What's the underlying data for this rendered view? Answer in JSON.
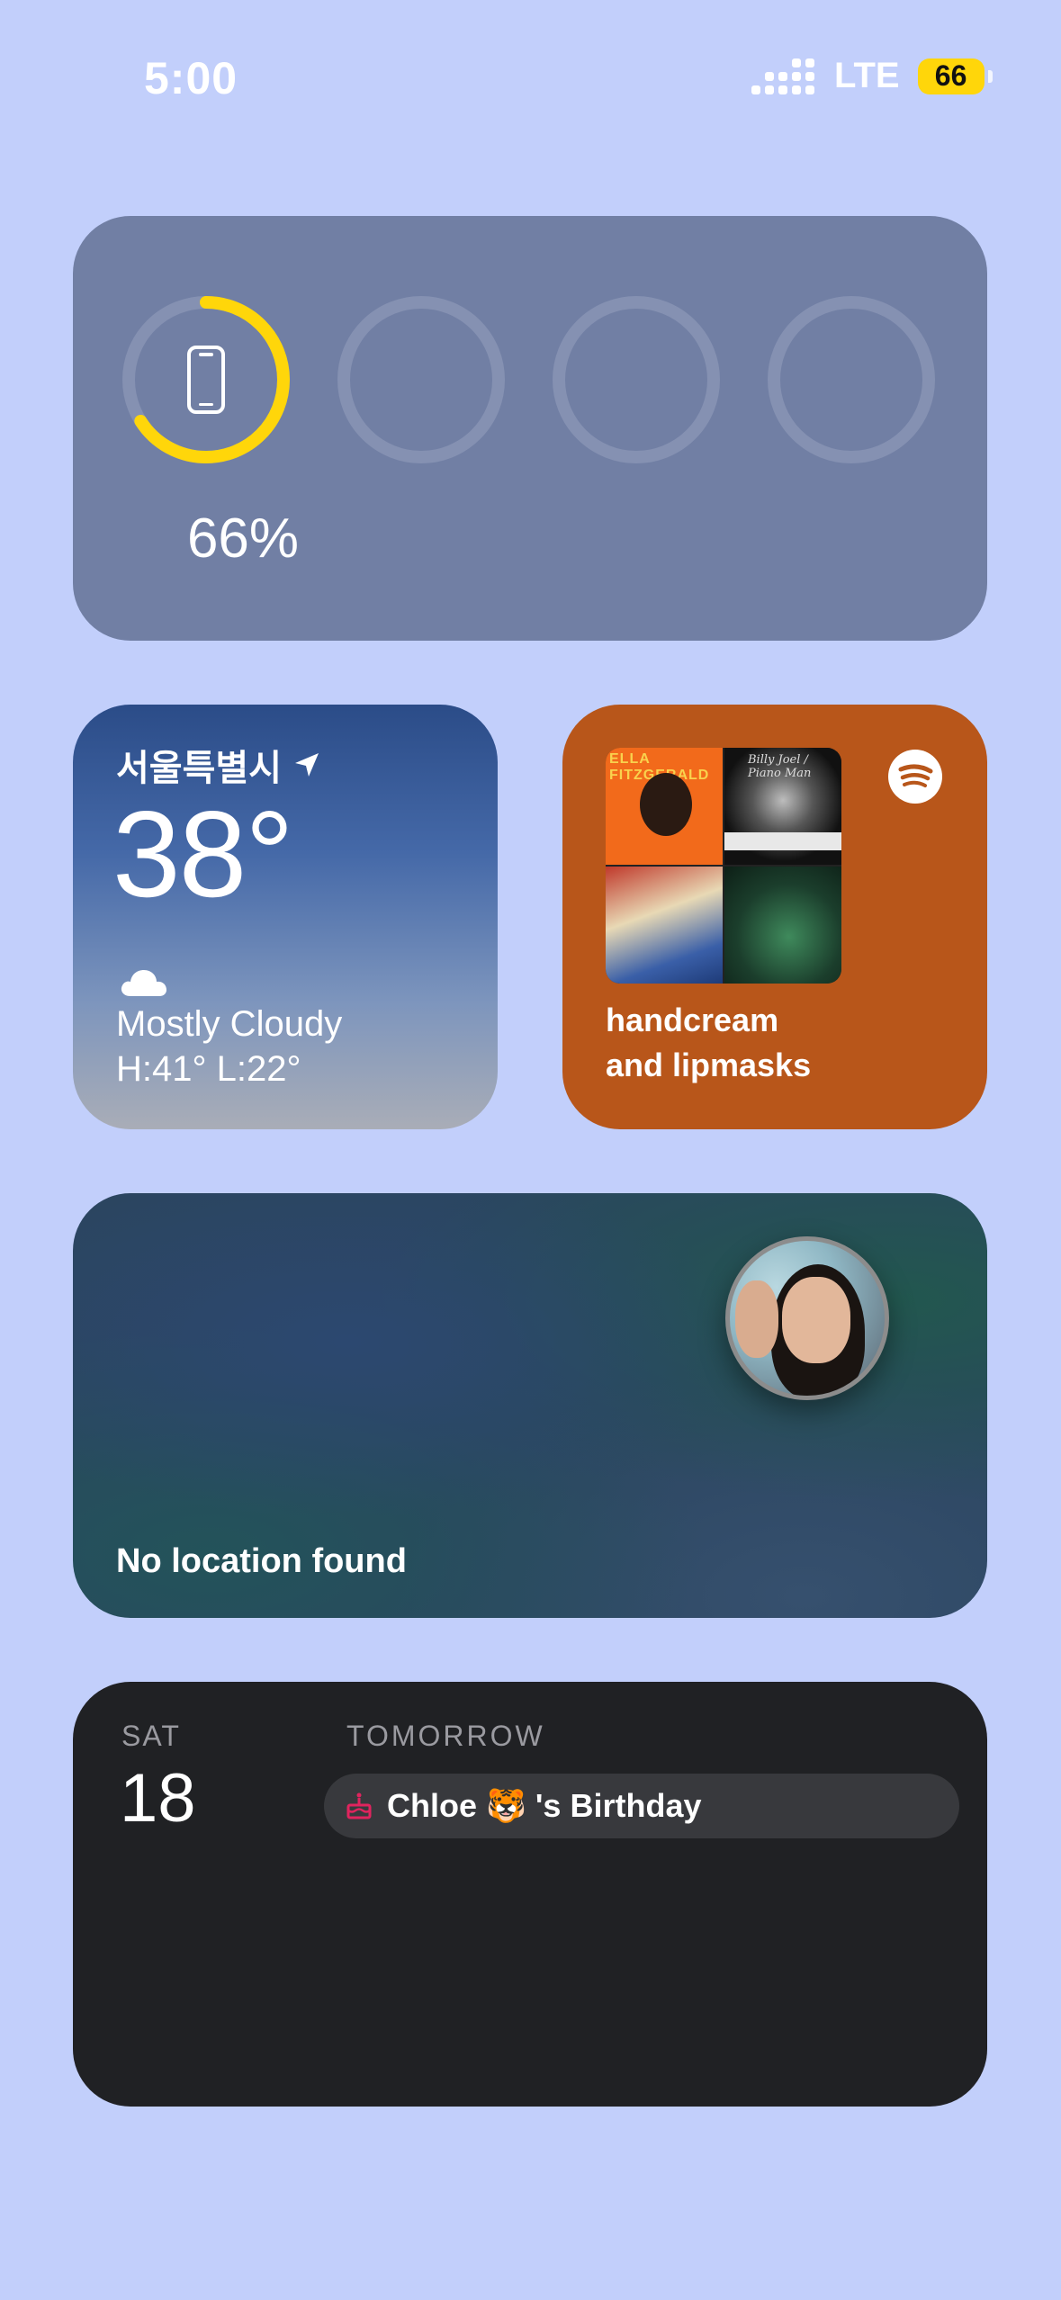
{
  "status_bar": {
    "time": "5:00",
    "network": "LTE",
    "battery": "66"
  },
  "batteries_widget": {
    "device_percent": "66%",
    "device_charge": 0.66,
    "accent": "#ffd60a",
    "ring_empty": "#8591b2"
  },
  "weather": {
    "city": "서울특별시",
    "temperature": "38°",
    "condition": "Mostly Cloudy",
    "high_low": "H:41° L:22°",
    "icon": "cloud-icon"
  },
  "spotify": {
    "line1": "handcream",
    "line2": "and lipmasks",
    "album1_title": "ELLA FITZGERALD",
    "album2_signature": "Billy Joel / Piano Man",
    "icon": "spotify-logo-icon",
    "accent": "#b8561a"
  },
  "findmy": {
    "status": "No location found"
  },
  "calendar": {
    "weekday": "SAT",
    "day": "18",
    "section": "TOMORROW",
    "event_name": "Chloe",
    "event_emoji": "🐯",
    "event_suffix": "'s Birthday",
    "event_accent": "#e0245e"
  }
}
